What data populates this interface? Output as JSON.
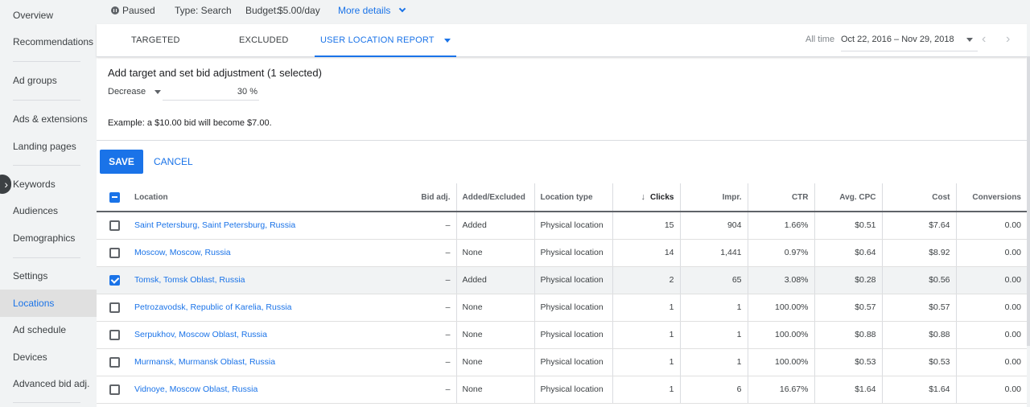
{
  "sidebar": {
    "items": [
      {
        "label": "Overview",
        "active": false
      },
      {
        "label": "Recommendations",
        "active": false
      },
      {
        "label": "Ad groups",
        "active": false
      },
      {
        "label": "Ads & extensions",
        "active": false
      },
      {
        "label": "Landing pages",
        "active": false
      },
      {
        "label": "Keywords",
        "active": false
      },
      {
        "label": "Audiences",
        "active": false
      },
      {
        "label": "Demographics",
        "active": false
      },
      {
        "label": "Settings",
        "active": false
      },
      {
        "label": "Locations",
        "active": true
      },
      {
        "label": "Ad schedule",
        "active": false
      },
      {
        "label": "Devices",
        "active": false
      },
      {
        "label": "Advanced bid adj.",
        "active": false
      }
    ]
  },
  "status": {
    "state": "Paused",
    "type": "Type: Search",
    "budget_label": "Budget:",
    "budget_value": "$5.00/day",
    "more_details": "More details"
  },
  "tabs": [
    {
      "label": "TARGETED",
      "active": false
    },
    {
      "label": "EXCLUDED",
      "active": false
    },
    {
      "label": "USER LOCATION REPORT",
      "active": true
    }
  ],
  "daterange": {
    "label": "All time",
    "value": "Oct 22, 2016 – Nov 29, 2018"
  },
  "bid_panel": {
    "title": "Add target and set bid adjustment (1 selected)",
    "direction": "Decrease",
    "amount": "30 %",
    "example": "Example: a $10.00 bid will become $7.00."
  },
  "actions": {
    "save": "SAVE",
    "cancel": "CANCEL"
  },
  "table": {
    "columns": [
      "Location",
      "Bid adj.",
      "Added/Excluded",
      "Location type",
      "Clicks",
      "Impr.",
      "CTR",
      "Avg. CPC",
      "Cost",
      "Conversions"
    ],
    "sorted_column": "Clicks",
    "rows": [
      {
        "selected": false,
        "location": "Saint Petersburg, Saint Petersburg, Russia",
        "bid_adj": "–",
        "added_excluded": "Added",
        "location_type": "Physical location",
        "clicks": "15",
        "impr": "904",
        "ctr": "1.66%",
        "avg_cpc": "$0.51",
        "cost": "$7.64",
        "conversions": "0.00"
      },
      {
        "selected": false,
        "location": "Moscow, Moscow, Russia",
        "bid_adj": "–",
        "added_excluded": "None",
        "location_type": "Physical location",
        "clicks": "14",
        "impr": "1,441",
        "ctr": "0.97%",
        "avg_cpc": "$0.64",
        "cost": "$8.92",
        "conversions": "0.00"
      },
      {
        "selected": true,
        "location": "Tomsk, Tomsk Oblast, Russia",
        "bid_adj": "–",
        "added_excluded": "Added",
        "location_type": "Physical location",
        "clicks": "2",
        "impr": "65",
        "ctr": "3.08%",
        "avg_cpc": "$0.28",
        "cost": "$0.56",
        "conversions": "0.00"
      },
      {
        "selected": false,
        "location": "Petrozavodsk, Republic of Karelia, Russia",
        "bid_adj": "–",
        "added_excluded": "None",
        "location_type": "Physical location",
        "clicks": "1",
        "impr": "1",
        "ctr": "100.00%",
        "avg_cpc": "$0.57",
        "cost": "$0.57",
        "conversions": "0.00"
      },
      {
        "selected": false,
        "location": "Serpukhov, Moscow Oblast, Russia",
        "bid_adj": "–",
        "added_excluded": "None",
        "location_type": "Physical location",
        "clicks": "1",
        "impr": "1",
        "ctr": "100.00%",
        "avg_cpc": "$0.88",
        "cost": "$0.88",
        "conversions": "0.00"
      },
      {
        "selected": false,
        "location": "Murmansk, Murmansk Oblast, Russia",
        "bid_adj": "–",
        "added_excluded": "None",
        "location_type": "Physical location",
        "clicks": "1",
        "impr": "1",
        "ctr": "100.00%",
        "avg_cpc": "$0.53",
        "cost": "$0.53",
        "conversions": "0.00"
      },
      {
        "selected": false,
        "location": "Vidnoye, Moscow Oblast, Russia",
        "bid_adj": "–",
        "added_excluded": "None",
        "location_type": "Physical location",
        "clicks": "1",
        "impr": "6",
        "ctr": "16.67%",
        "avg_cpc": "$1.64",
        "cost": "$1.64",
        "conversions": "0.00"
      }
    ]
  },
  "colors": {
    "accent": "#1a73e8",
    "sidebar_bg": "#f1f3f4",
    "active_nav_bg": "#e0e0e0"
  }
}
